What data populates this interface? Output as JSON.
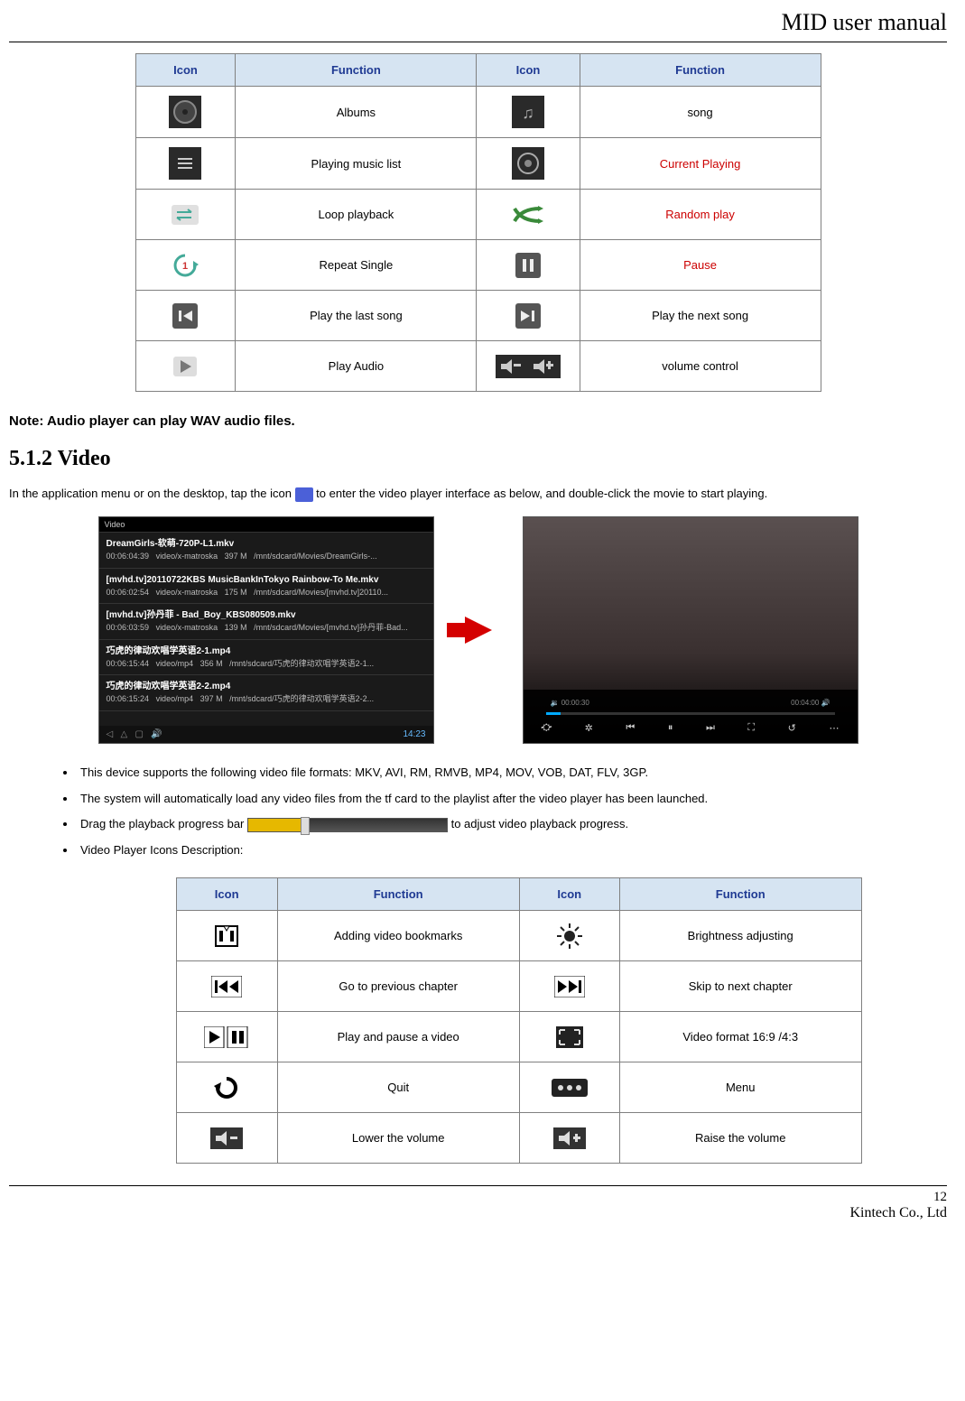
{
  "header": {
    "title": "MID user manual"
  },
  "table1": {
    "headers": {
      "icon": "Icon",
      "function": "Function"
    },
    "rows": [
      {
        "f1": "Albums",
        "f2": "song"
      },
      {
        "f1": "Playing music list",
        "f2": "Current Playing",
        "f2_red": true
      },
      {
        "f1": "Loop playback",
        "f2": "Random play",
        "f2_red": true
      },
      {
        "f1": "Repeat Single",
        "f2": "Pause",
        "f2_red": true
      },
      {
        "f1": "Play the last song",
        "f2": "Play the next song"
      },
      {
        "f1": "Play Audio",
        "f2": "volume control"
      }
    ]
  },
  "note": "Note: Audio player can play WAV audio files.",
  "section_heading": "5.1.2 Video",
  "intro": {
    "pre": "In the application menu or on the desktop, tap the icon ",
    "post": " to enter the video player interface as below, and double-click the movie to start playing."
  },
  "video_list": {
    "title": "Video",
    "items": [
      {
        "name": "DreamGirls-软萌-720P-L1.mkv",
        "dur": "00:06:04:39",
        "codec": "video/x-matroska",
        "size": "397 M",
        "path": "/mnt/sdcard/Movies/DreamGirls-..."
      },
      {
        "name": "[mvhd.tv]20110722KBS MusicBankInTokyo Rainbow-To Me.mkv",
        "dur": "00:06:02:54",
        "codec": "video/x-matroska",
        "size": "175 M",
        "path": "/mnt/sdcard/Movies/[mvhd.tv]20110..."
      },
      {
        "name": "[mvhd.tv]孙丹菲 - Bad_Boy_KBS080509.mkv",
        "dur": "00:06:03:59",
        "codec": "video/x-matroska",
        "size": "139 M",
        "path": "/mnt/sdcard/Movies/[mvhd.tv]孙丹菲-Bad..."
      },
      {
        "name": "巧虎的律动欢唱学英语2-1.mp4",
        "dur": "00:06:15:44",
        "codec": "video/mp4",
        "size": "356 M",
        "path": "/mnt/sdcard/巧虎的律动欢唱学英语2-1..."
      },
      {
        "name": "巧虎的律动欢唱学英语2-2.mp4",
        "dur": "00:06:15:24",
        "codec": "video/mp4",
        "size": "397 M",
        "path": "/mnt/sdcard/巧虎的律动欢唱学英语2-2..."
      }
    ],
    "status_time": "14:23"
  },
  "player": {
    "time_cur": "00:00:30",
    "time_total": "00:04:00"
  },
  "bullets": [
    "This device supports the following video file formats: MKV, AVI, RM, RMVB, MP4, MOV, VOB, DAT, FLV, 3GP.",
    "The system will automatically load any video files from the tf card to the playlist after the video player has been launched.",
    {
      "pre": "Drag the playback progress bar ",
      "post": " to adjust video playback progress."
    },
    "Video Player Icons Description:"
  ],
  "table2": {
    "headers": {
      "icon": "Icon",
      "function": "Function"
    },
    "rows": [
      {
        "f1": "Adding video bookmarks",
        "f2": "Brightness adjusting"
      },
      {
        "f1": "Go to previous chapter",
        "f2": "Skip to next chapter"
      },
      {
        "f1": "Play and pause a video",
        "f2": "Video format 16:9 /4:3"
      },
      {
        "f1": "Quit",
        "f2": "Menu"
      },
      {
        "f1": "Lower the volume",
        "f2": "Raise the volume"
      }
    ]
  },
  "footer": {
    "page": "12",
    "company": "Kintech Co., Ltd"
  }
}
